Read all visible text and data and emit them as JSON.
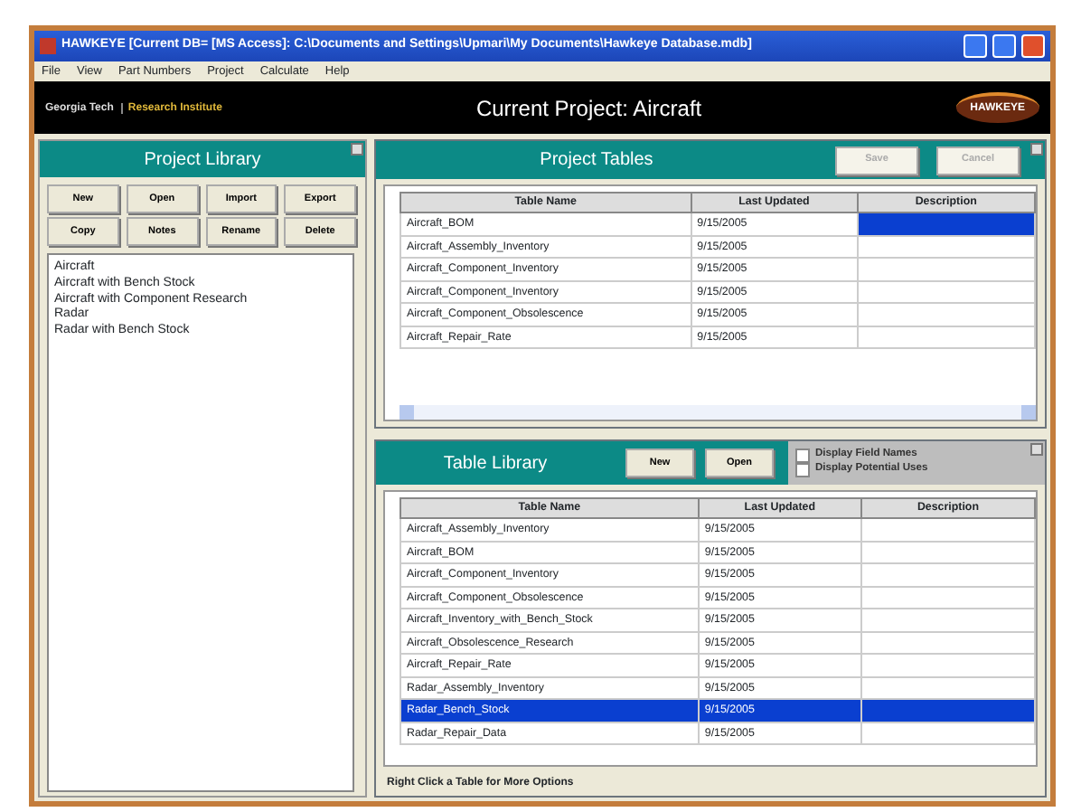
{
  "window": {
    "title": "HAWKEYE  [Current DB= [MS Access]: C:\\Documents and Settings\\Upmari\\My Documents\\Hawkeye Database.mdb]"
  },
  "menu": [
    "File",
    "View",
    "Part Numbers",
    "Project",
    "Calculate",
    "Help"
  ],
  "header": {
    "logo_left": "Georgia Tech",
    "logo_right": "Research Institute",
    "current_project": "Current Project:  Aircraft",
    "logo_brand": "HAWKEYE"
  },
  "project_library": {
    "title": "Project Library",
    "buttons": [
      "New",
      "Open",
      "Import",
      "Export",
      "Copy",
      "Notes",
      "Rename",
      "Delete"
    ],
    "projects": [
      "Aircraft",
      "Aircraft with Bench Stock",
      "Aircraft with Component Research",
      "Radar",
      "Radar with Bench Stock"
    ]
  },
  "project_tables": {
    "title": "Project Tables",
    "buttons": [
      {
        "label": "Save",
        "disabled": true
      },
      {
        "label": "Cancel",
        "disabled": true
      }
    ],
    "columns": [
      "Table Name",
      "Last Updated",
      "Description"
    ],
    "rows": [
      {
        "name": "Aircraft_BOM",
        "last_updated": "9/15/2005",
        "description_selected": true
      },
      {
        "name": "Aircraft_Assembly_Inventory",
        "last_updated": "9/15/2005",
        "description_selected": false
      },
      {
        "name": "Aircraft_Component_Inventory",
        "last_updated": "9/15/2005",
        "description_selected": false
      },
      {
        "name": "Aircraft_Component_Inventory",
        "last_updated": "9/15/2005",
        "description_selected": false
      },
      {
        "name": "Aircraft_Component_Obsolescence",
        "last_updated": "9/15/2005",
        "description_selected": false
      },
      {
        "name": "Aircraft_Repair_Rate",
        "last_updated": "9/15/2005",
        "description_selected": false
      }
    ]
  },
  "table_library": {
    "title": "Table Library",
    "buttons": [
      {
        "label": "New",
        "disabled": false
      },
      {
        "label": "Open",
        "disabled": false
      }
    ],
    "options": [
      {
        "label": "Display Field Names",
        "checked": false
      },
      {
        "label": "Display Potential Uses",
        "checked": false
      }
    ],
    "columns": [
      "Table Name",
      "Last Updated",
      "Description"
    ],
    "rows": [
      {
        "name": "Aircraft_Assembly_Inventory",
        "last_updated": "9/15/2005",
        "selected": false
      },
      {
        "name": "Aircraft_BOM",
        "last_updated": "9/15/2005",
        "selected": false
      },
      {
        "name": "Aircraft_Component_Inventory",
        "last_updated": "9/15/2005",
        "selected": false
      },
      {
        "name": "Aircraft_Component_Obsolescence",
        "last_updated": "9/15/2005",
        "selected": false
      },
      {
        "name": "Aircraft_Inventory_with_Bench_Stock",
        "last_updated": "9/15/2005",
        "selected": false
      },
      {
        "name": "Aircraft_Obsolescence_Research",
        "last_updated": "9/15/2005",
        "selected": false
      },
      {
        "name": "Aircraft_Repair_Rate",
        "last_updated": "9/15/2005",
        "selected": false
      },
      {
        "name": "Radar_Assembly_Inventory",
        "last_updated": "9/15/2005",
        "selected": false
      },
      {
        "name": "Radar_Bench_Stock",
        "last_updated": "9/15/2005",
        "selected": true
      },
      {
        "name": "Radar_Repair_Data",
        "last_updated": "9/15/2005",
        "selected": false
      }
    ],
    "status": "Right Click a Table for More Options"
  }
}
